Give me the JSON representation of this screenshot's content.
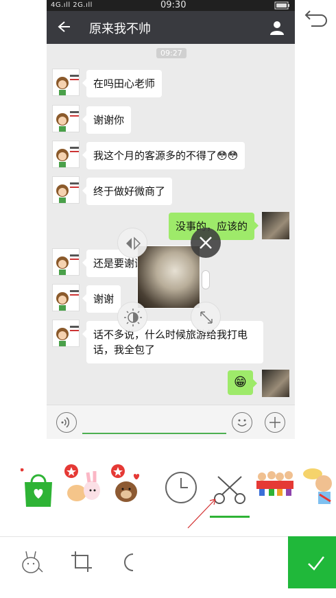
{
  "status_bar": {
    "left": "4G.ıll 2G.ıll",
    "time": "09:30",
    "right": "100%"
  },
  "header": {
    "title": "原来我不帅"
  },
  "timestamp": "09:27",
  "messages": [
    {
      "side": "left",
      "text": "在吗田心老师"
    },
    {
      "side": "left",
      "text": "谢谢你"
    },
    {
      "side": "left",
      "text": "我这个月的客源多的不得了😳😳"
    },
    {
      "side": "left",
      "text": "终于做好微商了"
    },
    {
      "side": "right",
      "text": "没事的，应该的"
    },
    {
      "side": "left",
      "text": "还是要谢谢你的指导"
    },
    {
      "side": "left",
      "text": "谢谢"
    },
    {
      "side": "left",
      "text": "话不多说，什么时候旅游给我打电话，我全包了"
    },
    {
      "side": "right",
      "text": "😁"
    }
  ],
  "colors": {
    "accent": "#20b83a",
    "title_bar": "#393a3f",
    "bubble_right": "#9eea6a"
  },
  "icons": [
    "back-arrow-icon",
    "person-icon",
    "voice-icon",
    "emoji-icon",
    "plus-icon",
    "undo-icon",
    "mirror-icon",
    "close-icon",
    "brightness-icon",
    "resize-icon",
    "shopping-bag-icon",
    "clock-icon",
    "scissors-icon",
    "sticker-icon",
    "crop-icon",
    "shape-icon",
    "send-icon"
  ]
}
